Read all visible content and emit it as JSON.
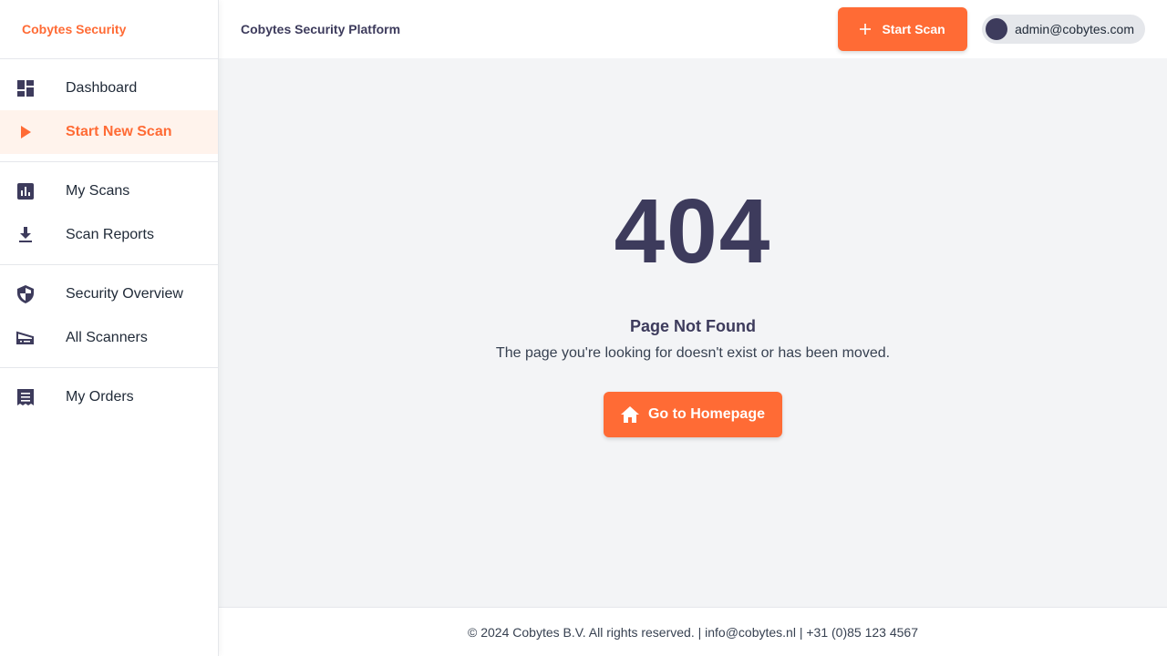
{
  "brand": {
    "name": "Cobytes Security",
    "color": "#ff6b35"
  },
  "sidebar": {
    "groups": [
      [
        {
          "label": "Dashboard",
          "icon": "dashboard-icon"
        },
        {
          "label": "Start New Scan",
          "icon": "play-icon",
          "active": true
        }
      ],
      [
        {
          "label": "My Scans",
          "icon": "chart-icon"
        },
        {
          "label": "Scan Reports",
          "icon": "download-icon"
        }
      ],
      [
        {
          "label": "Security Overview",
          "icon": "shield-icon"
        },
        {
          "label": "All Scanners",
          "icon": "scanner-icon"
        }
      ],
      [
        {
          "label": "My Orders",
          "icon": "receipt-icon"
        }
      ]
    ]
  },
  "header": {
    "title": "Cobytes Security Platform",
    "start_scan_label": "Start Scan",
    "user_email": "admin@cobytes.com"
  },
  "main": {
    "code": "404",
    "title": "Page Not Found",
    "message": "The page you're looking for doesn't exist or has been moved.",
    "button_label": "Go to Homepage"
  },
  "footer": {
    "text": "© 2024 Cobytes B.V. All rights reserved. | info@cobytes.nl | +31 (0)85 123 4567"
  },
  "colors": {
    "accent": "#ff6b35",
    "primary_dark": "#3d3b5c",
    "background": "#f3f4f6"
  }
}
